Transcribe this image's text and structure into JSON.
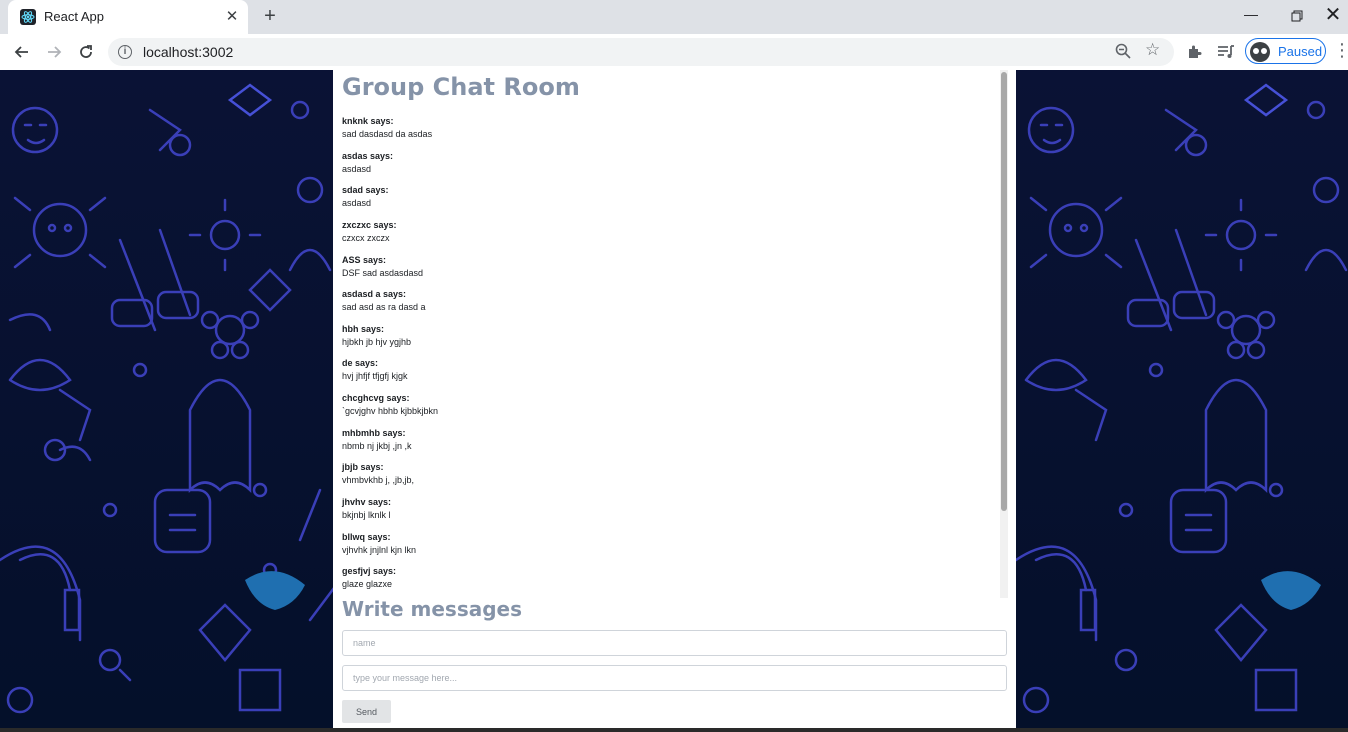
{
  "browser": {
    "tab_title": "React App",
    "url": "localhost:3002",
    "profile_label": "Paused"
  },
  "chat": {
    "title": "Group Chat Room",
    "messages": [
      {
        "author": "knknk says:",
        "text": "sad dasdasd da asdas"
      },
      {
        "author": "asdas says:",
        "text": "asdasd"
      },
      {
        "author": "sdad says:",
        "text": "asdasd"
      },
      {
        "author": "zxczxc says:",
        "text": "czxcx zxczx"
      },
      {
        "author": "ASS says:",
        "text": "DSF sad asdasdasd"
      },
      {
        "author": "asdasd a says:",
        "text": "sad asd as ra dasd a"
      },
      {
        "author": "hbh says:",
        "text": "hjbkh jb hjv ygjhb"
      },
      {
        "author": "de says:",
        "text": "hvj jhfjf tfjgfj kjgk"
      },
      {
        "author": "chcghcvg says:",
        "text": "`gcvjghv hbhb kjbbkjbkn"
      },
      {
        "author": "mhbmhb says:",
        "text": "nbmb nj jkbj ,jn ,k"
      },
      {
        "author": "jbjb says:",
        "text": "vhmbvkhb j, ,jb,jb,"
      },
      {
        "author": "jhvhv says:",
        "text": "bkjnbj lknlk l"
      },
      {
        "author": "bllwq says:",
        "text": "vjhvhk jnjlnl kjn lkn"
      },
      {
        "author": "gesfjvj says:",
        "text": "glaze glazxe"
      }
    ]
  },
  "composer": {
    "title": "Write messages",
    "name_placeholder": "name",
    "message_placeholder": "type your message here...",
    "send_label": "Send"
  }
}
